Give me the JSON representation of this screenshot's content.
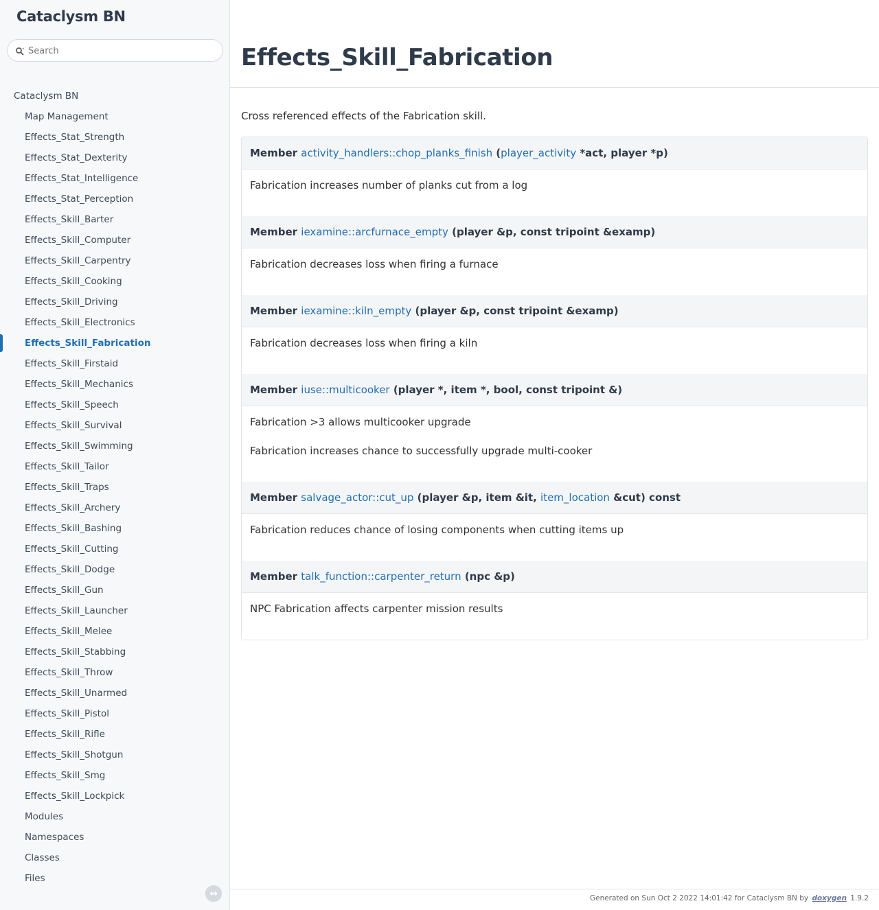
{
  "sidebar": {
    "project_title": "Cataclysm BN",
    "search": {
      "placeholder": "Search",
      "value": ""
    },
    "root_label": "Cataclysm BN",
    "items": [
      {
        "label": "Map Management",
        "active": false
      },
      {
        "label": "Effects_Stat_Strength",
        "active": false
      },
      {
        "label": "Effects_Stat_Dexterity",
        "active": false
      },
      {
        "label": "Effects_Stat_Intelligence",
        "active": false
      },
      {
        "label": "Effects_Stat_Perception",
        "active": false
      },
      {
        "label": "Effects_Skill_Barter",
        "active": false
      },
      {
        "label": "Effects_Skill_Computer",
        "active": false
      },
      {
        "label": "Effects_Skill_Carpentry",
        "active": false
      },
      {
        "label": "Effects_Skill_Cooking",
        "active": false
      },
      {
        "label": "Effects_Skill_Driving",
        "active": false
      },
      {
        "label": "Effects_Skill_Electronics",
        "active": false
      },
      {
        "label": "Effects_Skill_Fabrication",
        "active": true
      },
      {
        "label": "Effects_Skill_Firstaid",
        "active": false
      },
      {
        "label": "Effects_Skill_Mechanics",
        "active": false
      },
      {
        "label": "Effects_Skill_Speech",
        "active": false
      },
      {
        "label": "Effects_Skill_Survival",
        "active": false
      },
      {
        "label": "Effects_Skill_Swimming",
        "active": false
      },
      {
        "label": "Effects_Skill_Tailor",
        "active": false
      },
      {
        "label": "Effects_Skill_Traps",
        "active": false
      },
      {
        "label": "Effects_Skill_Archery",
        "active": false
      },
      {
        "label": "Effects_Skill_Bashing",
        "active": false
      },
      {
        "label": "Effects_Skill_Cutting",
        "active": false
      },
      {
        "label": "Effects_Skill_Dodge",
        "active": false
      },
      {
        "label": "Effects_Skill_Gun",
        "active": false
      },
      {
        "label": "Effects_Skill_Launcher",
        "active": false
      },
      {
        "label": "Effects_Skill_Melee",
        "active": false
      },
      {
        "label": "Effects_Skill_Stabbing",
        "active": false
      },
      {
        "label": "Effects_Skill_Throw",
        "active": false
      },
      {
        "label": "Effects_Skill_Unarmed",
        "active": false
      },
      {
        "label": "Effects_Skill_Pistol",
        "active": false
      },
      {
        "label": "Effects_Skill_Rifle",
        "active": false
      },
      {
        "label": "Effects_Skill_Shotgun",
        "active": false
      },
      {
        "label": "Effects_Skill_Smg",
        "active": false
      },
      {
        "label": "Effects_Skill_Lockpick",
        "active": false
      },
      {
        "label": "Modules",
        "active": false
      },
      {
        "label": "Namespaces",
        "active": false
      },
      {
        "label": "Classes",
        "active": false
      },
      {
        "label": "Files",
        "active": false
      }
    ]
  },
  "main": {
    "title": "Effects_Skill_Fabrication",
    "intro": "Cross referenced effects of the Fabrication skill.",
    "entries": [
      {
        "prefix": "Member",
        "parts": [
          {
            "text": "activity_handlers::chop_planks_finish",
            "link": true
          },
          {
            "text": " (",
            "link": false
          },
          {
            "text": "player_activity",
            "link": true
          },
          {
            "text": " *act, player *p)",
            "link": false
          }
        ],
        "descriptions": [
          "Fabrication increases number of planks cut from a log"
        ]
      },
      {
        "prefix": "Member",
        "parts": [
          {
            "text": "iexamine::arcfurnace_empty",
            "link": true
          },
          {
            "text": " (player &p, const tripoint &examp)",
            "link": false
          }
        ],
        "descriptions": [
          "Fabrication decreases loss when firing a furnace"
        ]
      },
      {
        "prefix": "Member",
        "parts": [
          {
            "text": "iexamine::kiln_empty",
            "link": true
          },
          {
            "text": " (player &p, const tripoint &examp)",
            "link": false
          }
        ],
        "descriptions": [
          "Fabrication decreases loss when firing a kiln"
        ]
      },
      {
        "prefix": "Member",
        "parts": [
          {
            "text": "iuse::multicooker",
            "link": true
          },
          {
            "text": " (player *, item *, bool, const tripoint &)",
            "link": false
          }
        ],
        "descriptions": [
          "Fabrication >3 allows multicooker upgrade",
          "Fabrication increases chance to successfully upgrade multi-cooker"
        ]
      },
      {
        "prefix": "Member",
        "parts": [
          {
            "text": "salvage_actor::cut_up",
            "link": true
          },
          {
            "text": " (player &p, item &it, ",
            "link": false
          },
          {
            "text": "item_location",
            "link": true
          },
          {
            "text": " &cut) const",
            "link": false
          }
        ],
        "descriptions": [
          "Fabrication reduces chance of losing components when cutting items up"
        ]
      },
      {
        "prefix": "Member",
        "parts": [
          {
            "text": "talk_function::carpenter_return",
            "link": true
          },
          {
            "text": " (npc &p)",
            "link": false
          }
        ],
        "descriptions": [
          "NPC Fabrication affects carpenter mission results"
        ]
      }
    ]
  },
  "footer": {
    "generated_text": "Generated on Sun Oct 2 2022 14:01:42 for Cataclysm BN by",
    "logo_text": "doxygen",
    "version": "1.9.2"
  },
  "colors": {
    "link": "#1f6fb2",
    "heading": "#2f3b4a",
    "sidebar_bg": "#f7f8f9",
    "entry_header_bg": "#f4f5f6"
  },
  "icons": {
    "search": "search-icon",
    "sync": "sync-icon"
  }
}
